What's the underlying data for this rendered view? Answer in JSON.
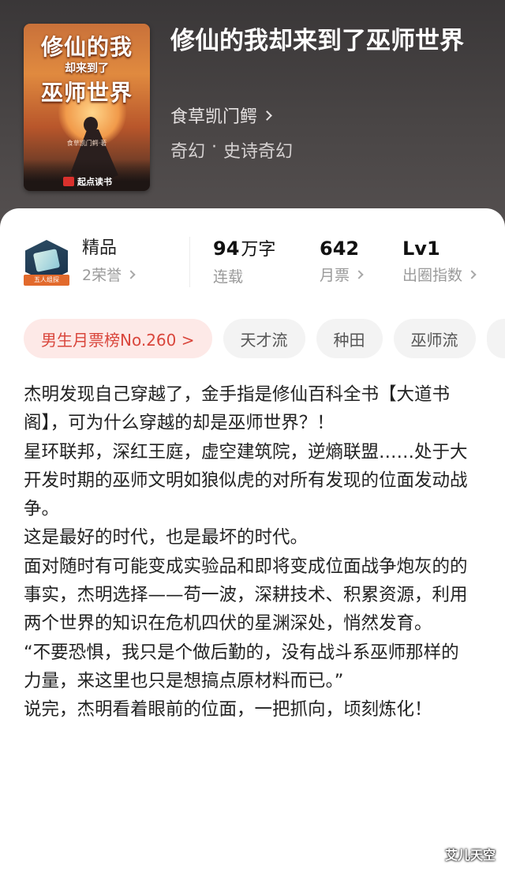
{
  "book": {
    "title": "修仙的我却来到了巫师世界",
    "author": "食草凯门鳄",
    "genre": "奇幻",
    "subgenre": "史诗奇幻",
    "separator": "·"
  },
  "cover": {
    "title_line1": "修仙的我",
    "title_line2": "却来到了",
    "title_line3": "巫师世界",
    "author": "食草凯门鳄·著",
    "publisher": "起点读书"
  },
  "stats": {
    "badge_ribbon": "五人组探",
    "quality_label": "精品",
    "honors": "2荣誉",
    "word_count_value": "94",
    "word_count_unit": "万字",
    "status": "连载",
    "monthly_tickets_value": "642",
    "monthly_tickets_label": "月票",
    "level_value": "Lv1",
    "level_label": "出圈指数"
  },
  "tags": [
    "男生月票榜No.260 >",
    "天才流",
    "种田",
    "巫师流"
  ],
  "synopsis": [
    "杰明发现自己穿越了，金手指是修仙百科全书【大道书阁】，可为什么穿越的却是巫师世界？！",
    "星环联邦，深红王庭，虚空建筑院，逆熵联盟……处于大开发时期的巫师文明如狼似虎的对所有发现的位面发动战争。",
    "这是最好的时代，也是最坏的时代。",
    "面对随时有可能变成实验品和即将变成位面战争炮灰的的事实，杰明选择——苟一波，深耕技术、积累资源，利用两个世界的知识在危机四伏的星渊深处，悄然发育。",
    "“不要恐惧，我只是个做后勤的，没有战斗系巫师那样的力量，来这里也只是想搞点原材料而已。”",
    "说完，杰明看着眼前的位面，一把抓向，顷刻炼化！"
  ],
  "watermark": "艾儿天空",
  "colors": {
    "header_bg": "#3a3738",
    "hot_tag_bg": "#fde9e7",
    "hot_tag_text": "#d9463c",
    "tag_bg": "#f3f3f3"
  }
}
